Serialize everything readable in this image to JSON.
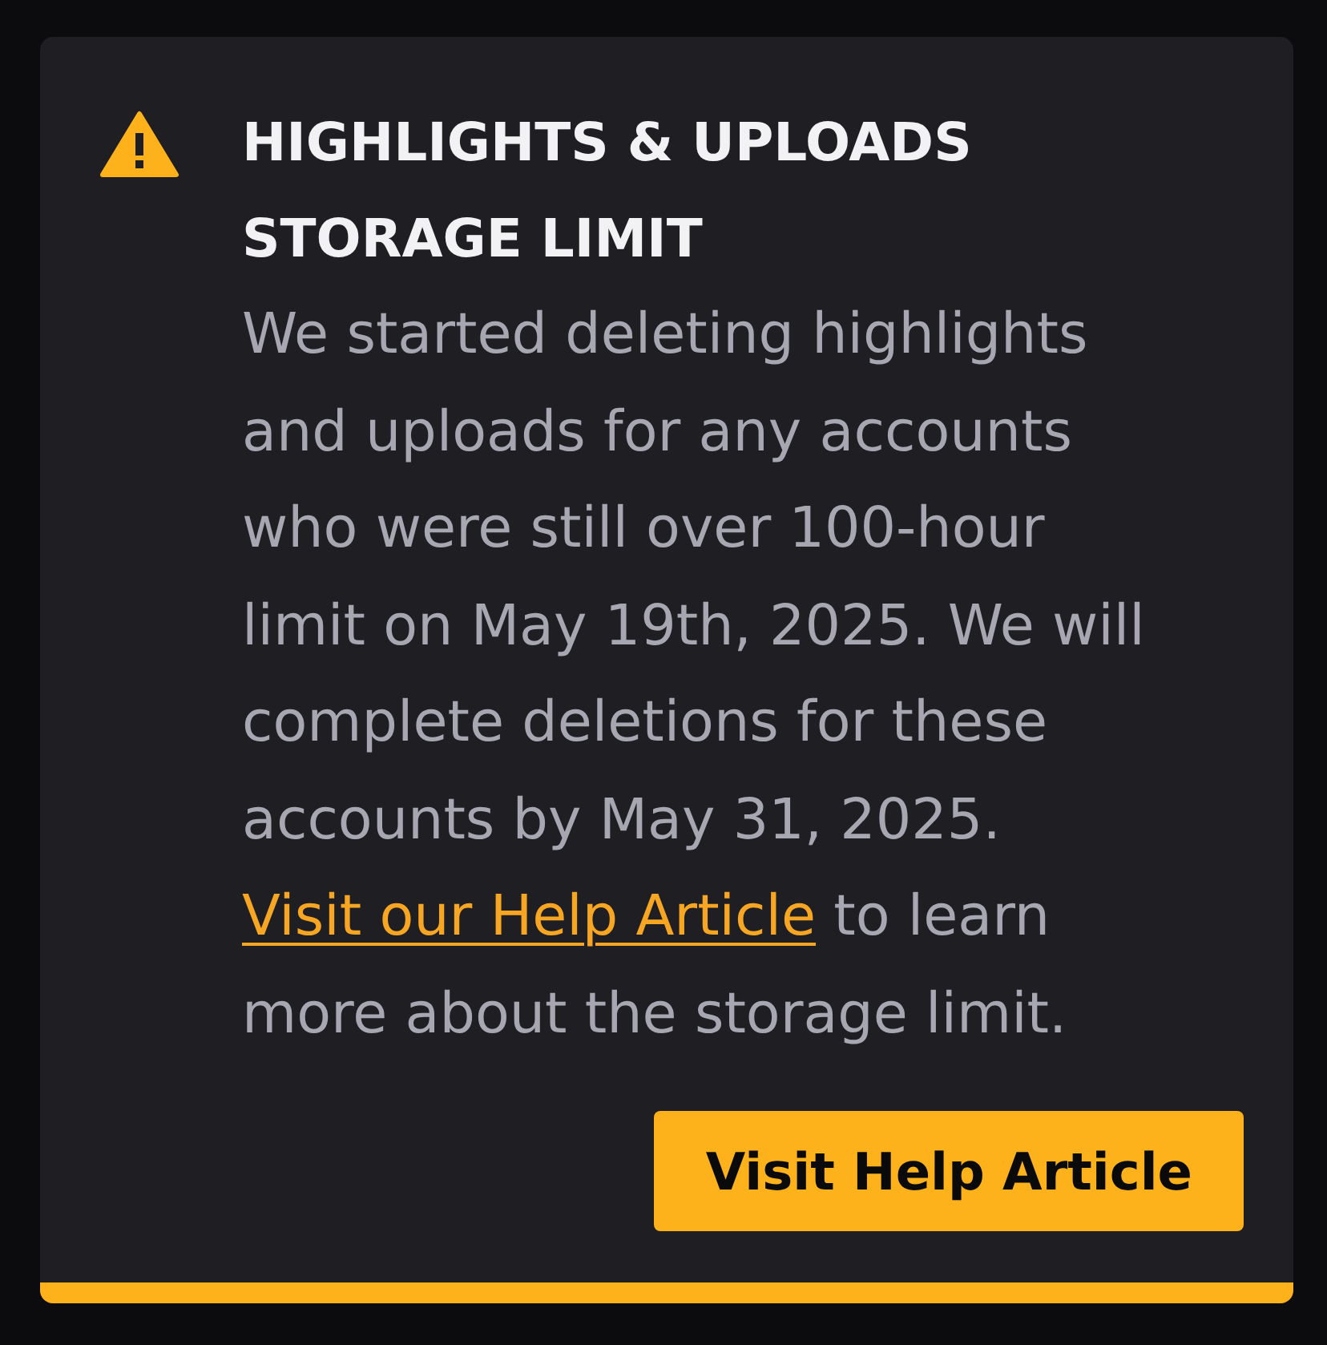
{
  "notice": {
    "title": "HIGHLIGHTS & UPLOADS STORAGE LIMIT",
    "body": {
      "before": "We started deleting highlights and uploads for any accounts who were still over 100-hour limit on May 19th, 2025. We will complete deletions for these accounts by May 31, 2025.",
      "link": "Visit our Help Article",
      "after": "to learn more about the storage limit."
    },
    "button": "Visit Help Article"
  }
}
